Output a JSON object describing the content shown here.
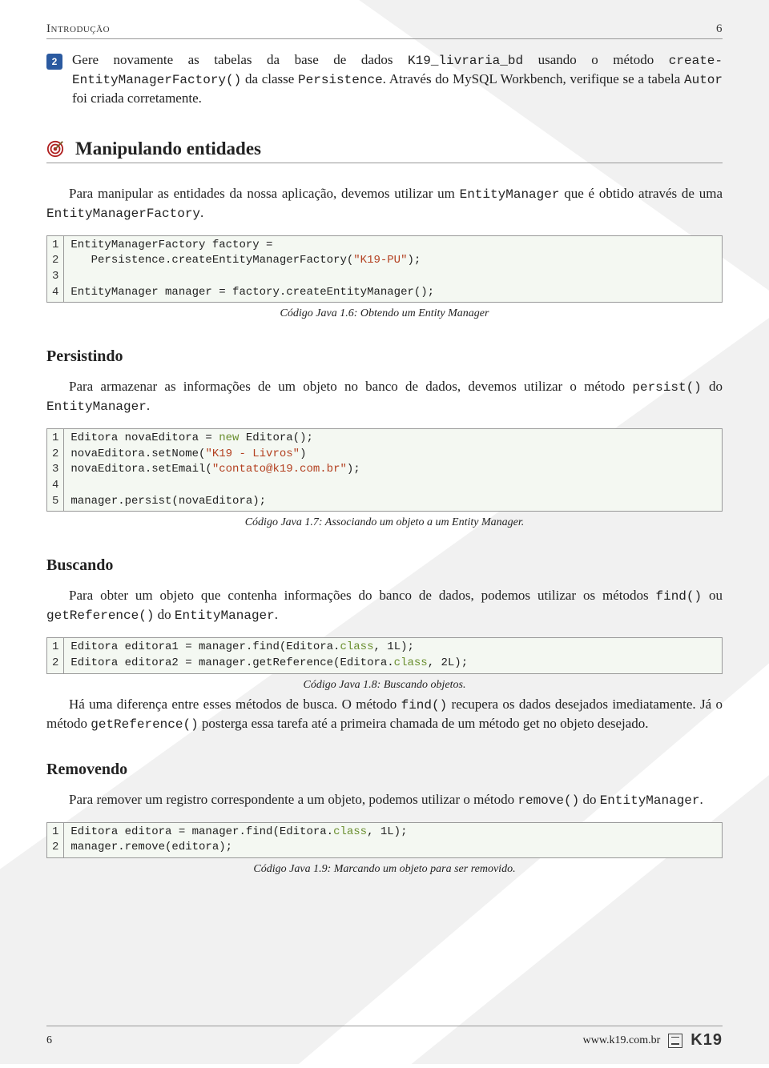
{
  "header": {
    "section": "Introdução",
    "page_top": "6"
  },
  "step": {
    "number": "2",
    "text_before": "Gere novamente as tabelas da base de dados ",
    "db": "K19_livraria_bd",
    "text_mid1": " usando o método ",
    "method": "create-EntityManagerFactory()",
    "text_mid2": " da classe ",
    "cls": "Persistence",
    "text_mid3": ". Através do MySQL Workbench, verifique se a tabela ",
    "tbl": "Autor",
    "text_after": " foi criada corretamente."
  },
  "section": {
    "title": "Manipulando entidades"
  },
  "p1": {
    "a": "Para manipular as entidades da nossa aplicação, devemos utilizar um ",
    "m1": "EntityManager",
    "b": " que é obtido através de uma ",
    "m2": "EntityManagerFactory",
    "c": "."
  },
  "code1": {
    "gutter": "1\n2\n3\n4",
    "l1a": "EntityManagerFactory factory =",
    "l2a": "   Persistence.createEntityManagerFactory(",
    "l2s": "\"K19-PU\"",
    "l2b": ");",
    "l3": "",
    "l4": "EntityManager manager = factory.createEntityManager();",
    "caption": "Código Java 1.6: Obtendo um Entity Manager"
  },
  "sub1": "Persistindo",
  "p2": {
    "a": "Para armazenar as informações de um objeto no banco de dados, devemos utilizar o método ",
    "m1": "persist()",
    "b": " do ",
    "m2": "EntityManager",
    "c": "."
  },
  "code2": {
    "gutter": "1\n2\n3\n4\n5",
    "l1a": "Editora novaEditora = ",
    "l1k": "new",
    "l1b": " Editora();",
    "l2a": "novaEditora.setNome(",
    "l2s": "\"K19 - Livros\"",
    "l2b": ")",
    "l3a": "novaEditora.setEmail(",
    "l3s": "\"contato@k19.com.br\"",
    "l3b": ");",
    "l4": "",
    "l5": "manager.persist(novaEditora);",
    "caption": "Código Java 1.7: Associando um objeto a um Entity Manager."
  },
  "sub2": "Buscando",
  "p3": {
    "a": "Para obter um objeto que contenha informações do banco de dados, podemos utilizar os métodos ",
    "m1": "find()",
    "b": " ou ",
    "m2": "getReference()",
    "c": " do ",
    "m3": "EntityManager",
    "d": "."
  },
  "code3": {
    "gutter": "1\n2",
    "l1a": "Editora editora1 = manager.find(Editora.",
    "l1k": "class",
    "l1b": ", 1L);",
    "l2a": "Editora editora2 = manager.getReference(Editora.",
    "l2k": "class",
    "l2b": ", 2L);",
    "caption": "Código Java 1.8: Buscando objetos."
  },
  "p4": {
    "a": "Há uma diferença entre esses métodos de busca. O método ",
    "m1": "find()",
    "b": " recupera os dados desejados imediatamente. Já o método ",
    "m2": "getReference()",
    "c": " posterga essa tarefa até a primeira chamada de um método get no objeto desejado."
  },
  "sub3": "Removendo",
  "p5": {
    "a": "Para remover um registro correspondente a um objeto, podemos utilizar o método ",
    "m1": "remove()",
    "b": " do ",
    "m2": "EntityManager",
    "c": "."
  },
  "code4": {
    "gutter": "1\n2",
    "l1a": "Editora editora = manager.find(Editora.",
    "l1k": "class",
    "l1b": ", 1L);",
    "l2": "manager.remove(editora);",
    "caption": "Código Java 1.9: Marcando um objeto para ser removido."
  },
  "footer": {
    "page_bottom": "6",
    "url": "www.k19.com.br",
    "logo": "K19"
  }
}
